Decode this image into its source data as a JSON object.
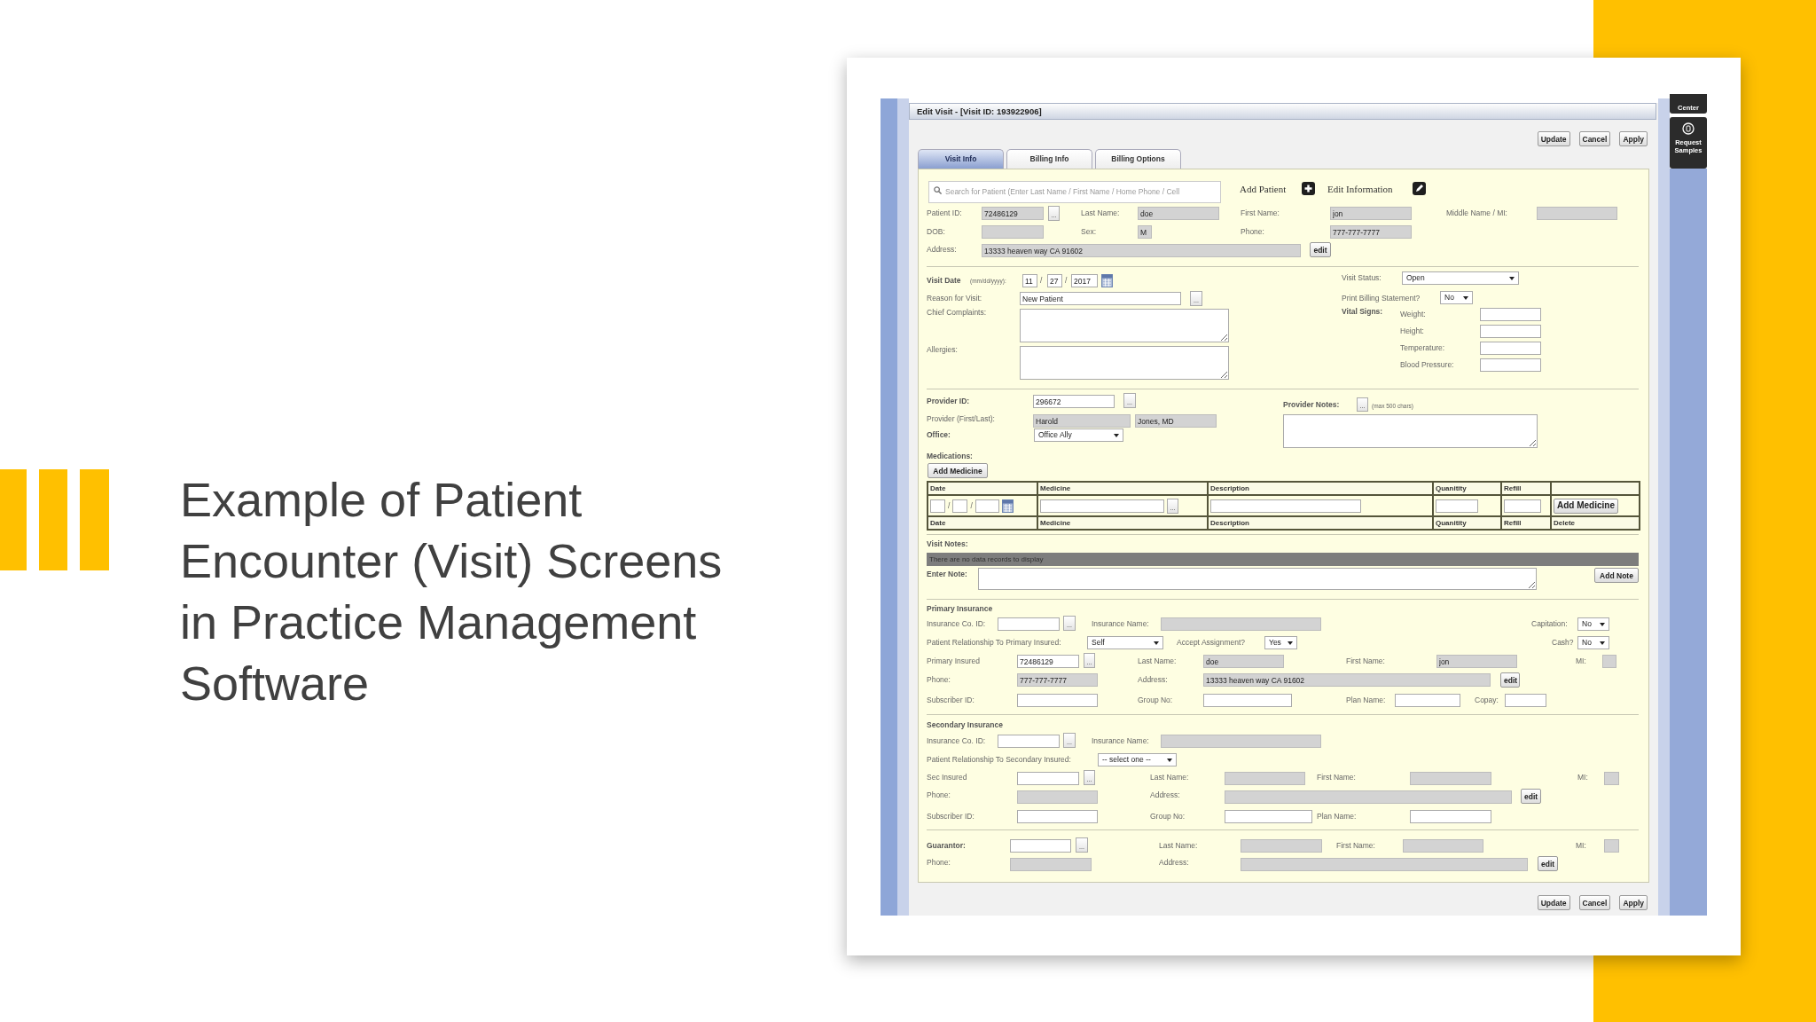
{
  "slide": {
    "title_lines": [
      "Example of Patient",
      "Encounter (Visit) Screens",
      "in Practice Management",
      "Software"
    ]
  },
  "window": {
    "title": "Edit Visit - [Visit ID: 193922906]"
  },
  "top_buttons": [
    "Update",
    "Cancel",
    "Apply"
  ],
  "side_buttons": [
    {
      "label": "Center"
    },
    {
      "label": "Request Samples"
    }
  ],
  "tabs": [
    {
      "label": "Visit Info",
      "selected": true
    },
    {
      "label": "Billing Info",
      "selected": false
    },
    {
      "label": "Billing Options",
      "selected": false
    }
  ],
  "sections": [
    {
      "items": [
        {
          "kind": "search",
          "placeholder": "Search for Patient (Enter Last Name / First Name / Home Phone / Cell"
        },
        {
          "kind": "action",
          "text": "Add Patient"
        },
        {
          "kind": "plus"
        },
        {
          "kind": "action",
          "text": "Edit Information"
        },
        {
          "kind": "pencil"
        },
        {
          "kind": "label",
          "text": "Patient ID:"
        },
        {
          "kind": "readonly",
          "value": "72486129"
        },
        {
          "kind": "lookup",
          "text": "..."
        },
        {
          "kind": "label",
          "text": "Last Name:"
        },
        {
          "kind": "readonly",
          "value": "doe"
        },
        {
          "kind": "label",
          "text": "First Name:"
        },
        {
          "kind": "readonly",
          "value": "jon"
        },
        {
          "kind": "label",
          "text": "Middle Name / MI:"
        },
        {
          "kind": "readonly"
        },
        {
          "kind": "label",
          "text": "DOB:"
        },
        {
          "kind": "readonly"
        },
        {
          "kind": "label",
          "text": "Sex:"
        },
        {
          "kind": "readonly",
          "value": "M"
        },
        {
          "kind": "label",
          "text": "Phone:"
        },
        {
          "kind": "readonly",
          "value": "777-777-7777"
        },
        {
          "kind": "label",
          "text": "Address:"
        },
        {
          "kind": "readonly",
          "value": "13333 heaven way CA 91602"
        },
        {
          "kind": "button",
          "text": "edit"
        }
      ]
    },
    {
      "items": [
        {
          "kind": "strong",
          "text": "Visit Date"
        },
        {
          "kind": "hint",
          "text": "(mm/dd/yyyy):"
        },
        {
          "kind": "input",
          "value": "11"
        },
        {
          "kind": "sep",
          "text": "/"
        },
        {
          "kind": "input",
          "value": "27"
        },
        {
          "kind": "sep",
          "text": "/"
        },
        {
          "kind": "input",
          "value": "2017"
        },
        {
          "kind": "calendar"
        },
        {
          "kind": "label",
          "text": "Visit Status:"
        },
        {
          "kind": "select",
          "value": "Open"
        },
        {
          "kind": "label",
          "text": "Reason for Visit:"
        },
        {
          "kind": "input",
          "value": "New Patient"
        },
        {
          "kind": "lookup",
          "text": "..."
        },
        {
          "kind": "label",
          "text": "Print Billing Statement?"
        },
        {
          "kind": "select",
          "value": "No"
        },
        {
          "kind": "label",
          "text": "Chief Complaints:"
        },
        {
          "kind": "textarea"
        },
        {
          "kind": "strong",
          "text": "Vital Signs:"
        },
        {
          "kind": "label",
          "text": "Weight:"
        },
        {
          "kind": "input"
        },
        {
          "kind": "label",
          "text": "Height:"
        },
        {
          "kind": "input"
        },
        {
          "kind": "label",
          "text": "Temperature:"
        },
        {
          "kind": "input"
        },
        {
          "kind": "label",
          "text": "Allergies:"
        },
        {
          "kind": "textarea"
        },
        {
          "kind": "label",
          "text": "Blood Pressure:"
        },
        {
          "kind": "input"
        }
      ]
    },
    {
      "items": [
        {
          "kind": "strong",
          "text": "Provider ID:"
        },
        {
          "kind": "input",
          "value": "296672"
        },
        {
          "kind": "lookup",
          "text": "..."
        },
        {
          "kind": "strong",
          "text": "Provider Notes:"
        },
        {
          "kind": "lookup",
          "text": "..."
        },
        {
          "kind": "hint",
          "text": "(max 500 chars)"
        },
        {
          "kind": "label",
          "text": "Provider (First/Last):"
        },
        {
          "kind": "readonly",
          "value": "Harold"
        },
        {
          "kind": "readonly",
          "value": "Jones, MD"
        },
        {
          "kind": "textarea"
        },
        {
          "kind": "strong",
          "text": "Office:"
        },
        {
          "kind": "select",
          "value": "Office Ally"
        }
      ]
    },
    {
      "items": [
        {
          "kind": "strong",
          "text": "Medications:"
        },
        {
          "kind": "button",
          "text": "Add Medicine"
        }
      ],
      "table": {
        "columns": [
          "Date",
          "Medicine",
          "Description",
          "Quanitity",
          "Refill"
        ],
        "date_separators": [
          "/",
          "/"
        ],
        "lookup": "...",
        "button": "Add Medicine",
        "footer": [
          "Date",
          "Medicine",
          "Description",
          "Quanitity",
          "Refill",
          "Delete"
        ]
      }
    },
    {
      "items": [
        {
          "kind": "strong",
          "text": "Visit Notes:"
        },
        {
          "kind": "notice",
          "text": "There are no data records to display"
        },
        {
          "kind": "strong",
          "text": "Enter Note:"
        },
        {
          "kind": "textarea"
        },
        {
          "kind": "button",
          "text": "Add Note"
        }
      ]
    },
    {
      "items": [
        {
          "kind": "strong",
          "text": "Primary Insurance"
        },
        {
          "kind": "label",
          "text": "Insurance Co. ID:"
        },
        {
          "kind": "input"
        },
        {
          "kind": "lookup",
          "text": "..."
        },
        {
          "kind": "label",
          "text": "Insurance Name:"
        },
        {
          "kind": "readonly"
        },
        {
          "kind": "label",
          "text": "Capitation:"
        },
        {
          "kind": "select",
          "value": "No"
        },
        {
          "kind": "label",
          "text": "Patient Relationship To Primary Insured:"
        },
        {
          "kind": "select",
          "value": "Self"
        },
        {
          "kind": "label",
          "text": "Accept Assignment?"
        },
        {
          "kind": "select",
          "value": "Yes"
        },
        {
          "kind": "label",
          "text": "Cash?"
        },
        {
          "kind": "select",
          "value": "No"
        },
        {
          "kind": "label",
          "text": "Primary Insured"
        },
        {
          "kind": "input",
          "value": "72486129"
        },
        {
          "kind": "lookup",
          "text": "..."
        },
        {
          "kind": "label",
          "text": "Last Name:"
        },
        {
          "kind": "readonly",
          "value": "doe"
        },
        {
          "kind": "label",
          "text": "First Name:"
        },
        {
          "kind": "readonly",
          "value": "jon"
        },
        {
          "kind": "label",
          "text": "MI:"
        },
        {
          "kind": "readonly"
        },
        {
          "kind": "label",
          "text": "Phone:"
        },
        {
          "kind": "readonly",
          "value": "777-777-7777"
        },
        {
          "kind": "label",
          "text": "Address:"
        },
        {
          "kind": "readonly",
          "value": "13333 heaven way CA 91602"
        },
        {
          "kind": "button",
          "text": "edit"
        },
        {
          "kind": "label",
          "text": "Subscriber ID:"
        },
        {
          "kind": "input"
        },
        {
          "kind": "label",
          "text": "Group No:"
        },
        {
          "kind": "input"
        },
        {
          "kind": "label",
          "text": "Plan Name:"
        },
        {
          "kind": "input"
        },
        {
          "kind": "label",
          "text": "Copay:"
        },
        {
          "kind": "input"
        }
      ]
    },
    {
      "items": [
        {
          "kind": "strong",
          "text": "Secondary Insurance"
        },
        {
          "kind": "label",
          "text": "Insurance Co. ID:"
        },
        {
          "kind": "input"
        },
        {
          "kind": "lookup",
          "text": "..."
        },
        {
          "kind": "label",
          "text": "Insurance Name:"
        },
        {
          "kind": "readonly"
        },
        {
          "kind": "label",
          "text": "Patient Relationship To Secondary Insured:"
        },
        {
          "kind": "select",
          "value": "-- select one --"
        },
        {
          "kind": "label",
          "text": "Sec Insured"
        },
        {
          "kind": "input"
        },
        {
          "kind": "lookup",
          "text": "..."
        },
        {
          "kind": "label",
          "text": "Last Name:"
        },
        {
          "kind": "readonly"
        },
        {
          "kind": "label",
          "text": "First Name:"
        },
        {
          "kind": "readonly"
        },
        {
          "kind": "label",
          "text": "MI:"
        },
        {
          "kind": "readonly"
        },
        {
          "kind": "label",
          "text": "Phone:"
        },
        {
          "kind": "readonly"
        },
        {
          "kind": "label",
          "text": "Address:"
        },
        {
          "kind": "readonly"
        },
        {
          "kind": "button",
          "text": "edit"
        },
        {
          "kind": "label",
          "text": "Subscriber ID:"
        },
        {
          "kind": "input"
        },
        {
          "kind": "label",
          "text": "Group No:"
        },
        {
          "kind": "input"
        },
        {
          "kind": "label",
          "text": "Plan Name:"
        },
        {
          "kind": "input"
        }
      ]
    },
    {
      "items": [
        {
          "kind": "strong",
          "text": "Guarantor:"
        },
        {
          "kind": "input"
        },
        {
          "kind": "lookup",
          "text": "..."
        },
        {
          "kind": "label",
          "text": "Last Name:"
        },
        {
          "kind": "readonly"
        },
        {
          "kind": "label",
          "text": "First Name:"
        },
        {
          "kind": "readonly"
        },
        {
          "kind": "label",
          "text": "MI:"
        },
        {
          "kind": "readonly"
        },
        {
          "kind": "label",
          "text": "Phone:"
        },
        {
          "kind": "readonly"
        },
        {
          "kind": "label",
          "text": "Address:"
        },
        {
          "kind": "readonly"
        },
        {
          "kind": "button",
          "text": "edit"
        }
      ]
    }
  ],
  "bottom_buttons": [
    "Update",
    "Cancel",
    "Apply"
  ]
}
